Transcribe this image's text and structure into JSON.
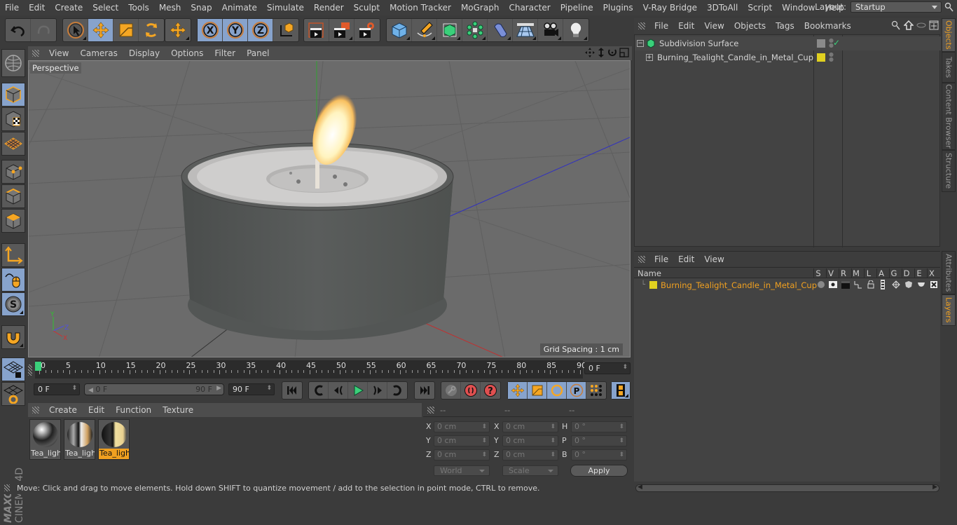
{
  "menubar": {
    "items": [
      "File",
      "Edit",
      "Create",
      "Select",
      "Tools",
      "Mesh",
      "Snap",
      "Animate",
      "Simulate",
      "Render",
      "Sculpt",
      "Motion Tracker",
      "MoGraph",
      "Character",
      "Pipeline",
      "Plugins",
      "V-Ray Bridge",
      "3DToAll",
      "Script",
      "Window",
      "Help"
    ],
    "layout_label": "Layout:",
    "layout_value": "Startup"
  },
  "toolbar": {
    "groups": [
      [
        "undo-icon",
        "redo-icon"
      ],
      [
        "live-selection-icon",
        "move-icon",
        "scale-icon",
        "rotate-icon"
      ],
      [
        "recent-tools-icon"
      ],
      [
        "x-axis-icon",
        "y-axis-icon",
        "z-axis-icon",
        "coordinate-system-icon"
      ],
      [
        "render-view-icon",
        "render-picture-viewer-icon",
        "render-settings-icon"
      ],
      [
        "cube-icon",
        "pen-spline-icon",
        "subdivision-icon",
        "cloner-icon",
        "deformer-icon",
        "floor-icon",
        "camera-icon",
        "light-icon"
      ]
    ]
  },
  "left_palette": [
    "make-editable-icon",
    "model-mode-icon",
    "texture-mode-icon",
    "workplane-mode-icon",
    "points-mode-icon",
    "edges-mode-icon",
    "polygons-mode-icon",
    "axis-mode-icon",
    "tweak-mode-icon",
    "solo-icon",
    "snap-magnet-icon",
    "lock-workplane-icon",
    "workplane-snap-icon"
  ],
  "viewport": {
    "menu": [
      "View",
      "Cameras",
      "Display",
      "Options",
      "Filter",
      "Panel"
    ],
    "camera_label": "Perspective",
    "grid_spacing": "Grid Spacing : 1 cm",
    "axis_labels": {
      "x": "X",
      "y": "Y",
      "z": "Z"
    }
  },
  "timeline": {
    "ticks": [
      "0",
      "5",
      "10",
      "15",
      "20",
      "25",
      "30",
      "35",
      "40",
      "45",
      "50",
      "55",
      "60",
      "65",
      "70",
      "75",
      "80",
      "85",
      "90"
    ],
    "current_frame": "0 F",
    "start_field": "0 F",
    "range_start": "0 F",
    "range_end": "90 F",
    "end_field": "90 F"
  },
  "material_manager": {
    "menu": [
      "Create",
      "Edit",
      "Function",
      "Texture"
    ],
    "materials": [
      {
        "name": "Tea_ligh",
        "selected": false
      },
      {
        "name": "Tea_ligh",
        "selected": false
      },
      {
        "name": "Tea_ligh",
        "selected": true
      }
    ]
  },
  "coordinates": {
    "headers": [
      "--",
      "--",
      "--"
    ],
    "rows": [
      {
        "l1": "X",
        "v1": "0 cm",
        "l2": "X",
        "v2": "0 cm",
        "l3": "H",
        "v3": "0 °"
      },
      {
        "l1": "Y",
        "v1": "0 cm",
        "l2": "Y",
        "v2": "0 cm",
        "l3": "P",
        "v3": "0 °"
      },
      {
        "l1": "Z",
        "v1": "0 cm",
        "l2": "Z",
        "v2": "0 cm",
        "l3": "B",
        "v3": "0 °"
      }
    ],
    "mode": "World",
    "size_mode": "Scale",
    "apply": "Apply"
  },
  "status": "Move: Click and drag to move elements. Hold down SHIFT to quantize movement / add to the selection in point mode, CTRL to remove.",
  "object_manager": {
    "menu": [
      "File",
      "Edit",
      "View",
      "Objects",
      "Tags",
      "Bookmarks"
    ],
    "objects": [
      {
        "name": "Subdivision Surface"
      },
      {
        "name": "Burning_Tealight_Candle_in_Metal_Cup"
      }
    ]
  },
  "side_tabs": {
    "top": [
      "Objects",
      "Takes",
      "Content Browser",
      "Structure"
    ],
    "bottom": [
      "Attributes",
      "Layers"
    ]
  },
  "layer_manager": {
    "menu": [
      "File",
      "Edit",
      "View"
    ],
    "columns": [
      "Name",
      "S",
      "V",
      "R",
      "M",
      "L",
      "A",
      "G",
      "D",
      "E",
      "X"
    ],
    "layers": [
      {
        "name": "Burning_Tealight_Candle_in_Metal_Cup",
        "color": "#e0d020"
      }
    ]
  },
  "colors": {
    "accent": "#f0a020",
    "active_button": "#87a3cc",
    "layer_color": "#e0d020"
  }
}
